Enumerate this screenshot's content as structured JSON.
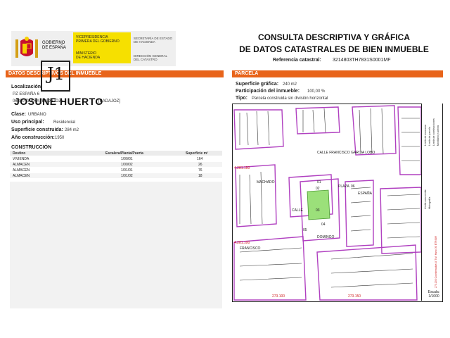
{
  "header": {
    "gobierno": [
      "GOBIERNO",
      "DE ESPAÑA"
    ],
    "vicepresidencia": "VICEPRESIDENCIA\nPRIMERA DEL GOBIERNO",
    "ministerio": "MINISTERIO\nDE HACIENDA",
    "secretaria": "SECRETARÍA DE ESTADO\nDE HACIENDA",
    "direccion": "DIRECCIÓN GENERAL\nDEL CATASTRO",
    "title_line1": "CONSULTA DESCRIPTIVA Y GRÁFICA",
    "title_line2": "DE DATOS CATASTRALES DE BIEN INMUEBLE",
    "ref_label": "Referencia catastral:",
    "ref_value": "3214803TH7831S0001MF"
  },
  "left": {
    "bar_title": "DATOS DESCRIPTIVOS DEL INMUEBLE",
    "localizacion_label": "Localización:",
    "localizacion_line1": "PZ ESPAÑA 6",
    "localizacion_line2": "06300 ZAFRA (BADAJOZ)",
    "localizacion_province": "[BADAJOZ]",
    "clase_label": "Clase:",
    "clase_value": "URBANO",
    "uso_label": "Uso principal:",
    "uso_value": "Residencial",
    "sup_label": "Superficie construida:",
    "sup_value": "284 m2",
    "anio_label": "Año construcción:",
    "anio_value": "1950",
    "construccion_label": "CONSTRUCCIÓN",
    "table": {
      "headers": [
        "Destino",
        "Escalera/Planta/Puerta",
        "Superficie m²"
      ],
      "rows": [
        [
          "VIVIENDA",
          "1/00/01",
          "164"
        ],
        [
          "ALMACEN",
          "1/00/02",
          "26"
        ],
        [
          "ALMACEN",
          "1/01/01",
          "76"
        ],
        [
          "ALMACEN",
          "1/01/02",
          "18"
        ]
      ]
    }
  },
  "right": {
    "bar_title": "PARCELA",
    "sup_grafica_label": "Superficie gráfica:",
    "sup_grafica_value": "240 m2",
    "participacion_label": "Participación del inmueble:",
    "participacion_value": "100,00 %",
    "tipo_label": "Tipo:",
    "tipo_value": "Parcela construida sin división horizontal"
  },
  "map": {
    "street_labels": [
      "CALLE FRANCISCO GARCIA LOBO",
      "MACHADO",
      "PLAZA",
      "ESPAÑA",
      "CALLE",
      "DOMINGO",
      "FRANCISCO"
    ],
    "coord_labels": [
      "4.281.150",
      "4.281.100",
      "273.100",
      "273.150"
    ],
    "parcel_labels": [
      "02",
      "03",
      "04",
      "05",
      "06",
      "01"
    ],
    "legend": [
      "Límite de manzana",
      "Límite de parcela",
      "Límite de construcciones",
      "Mobiliario y aceras",
      "Límite zona verde",
      "Hidrografía"
    ],
    "coords_note": "273.200 Coordenadas U.T.M. Huso 30 ETRS89",
    "scale_label": "Escala:",
    "scale_value": "1/1000"
  },
  "watermark": {
    "monogram": "J1",
    "brand": "JOSUNE HUERTO"
  },
  "colors": {
    "orange_bar": "#e8641a",
    "gov_yellow": "#f6e000",
    "parcel_green": "#9be07a",
    "parcel_line": "#b040c0"
  }
}
